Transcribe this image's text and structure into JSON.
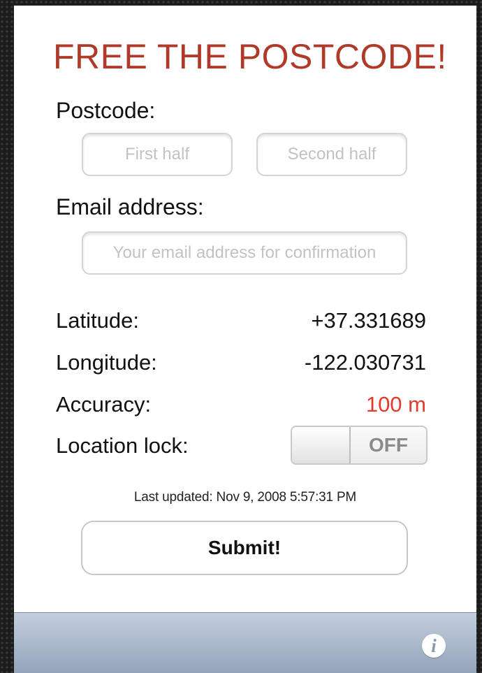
{
  "app": {
    "title": "FREE THE POSTCODE!"
  },
  "postcode": {
    "label": "Postcode:",
    "first_half_placeholder": "First half",
    "first_half_value": "",
    "second_half_placeholder": "Second half",
    "second_half_value": ""
  },
  "email": {
    "label": "Email address:",
    "placeholder": "Your email address for confirmation",
    "value": ""
  },
  "location": {
    "latitude_label": "Latitude:",
    "latitude_value": "+37.331689",
    "longitude_label": "Longitude:",
    "longitude_value": "-122.030731",
    "accuracy_label": "Accuracy:",
    "accuracy_value": "100 m",
    "accuracy_color": "#e23b2e",
    "lock_label": "Location lock:",
    "lock_state": "OFF"
  },
  "status": {
    "last_updated": "Last updated: Nov 9, 2008 5:57:31 PM"
  },
  "actions": {
    "submit_label": "Submit!"
  },
  "toolbar": {
    "info_icon": "info-icon",
    "info_glyph": "i"
  },
  "theme": {
    "title_color": "#b03a2a",
    "toolbar_color": "#a9b6c9"
  }
}
